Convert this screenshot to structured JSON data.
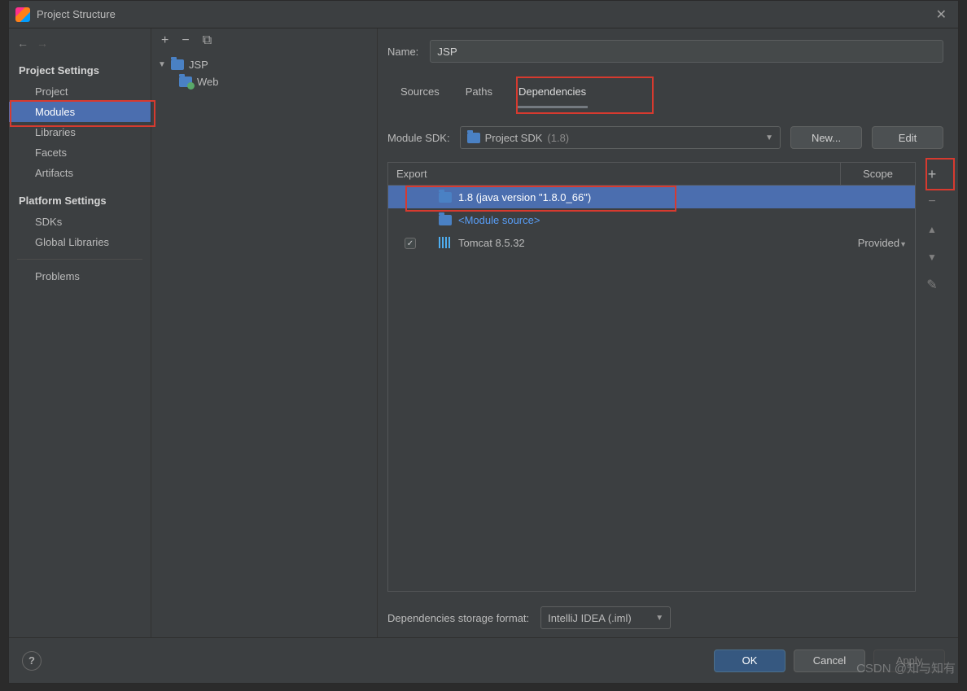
{
  "window": {
    "title": "Project Structure"
  },
  "sidebar": {
    "sections": [
      {
        "header": "Project Settings",
        "items": [
          {
            "label": "Project",
            "selected": false
          },
          {
            "label": "Modules",
            "selected": true
          },
          {
            "label": "Libraries",
            "selected": false
          },
          {
            "label": "Facets",
            "selected": false
          },
          {
            "label": "Artifacts",
            "selected": false
          }
        ]
      },
      {
        "header": "Platform Settings",
        "items": [
          {
            "label": "SDKs",
            "selected": false
          },
          {
            "label": "Global Libraries",
            "selected": false
          }
        ]
      }
    ],
    "problems": "Problems"
  },
  "tree": {
    "root": {
      "label": "JSP",
      "expanded": true
    },
    "children": [
      {
        "label": "Web"
      }
    ]
  },
  "module": {
    "name_label": "Name:",
    "name_value": "JSP",
    "tabs": [
      {
        "label": "Sources",
        "active": false
      },
      {
        "label": "Paths",
        "active": false
      },
      {
        "label": "Dependencies",
        "active": true
      }
    ],
    "sdk": {
      "label": "Module SDK:",
      "value": "Project SDK",
      "hint": "(1.8)",
      "new": "New...",
      "edit": "Edit"
    },
    "deps": {
      "header_export": "Export",
      "header_scope": "Scope",
      "rows": [
        {
          "checked": null,
          "icon": "folder",
          "text": "1.8 (java version \"1.8.0_66\")",
          "scope": "",
          "selected": true,
          "link": false
        },
        {
          "checked": null,
          "icon": "folder",
          "text": "<Module source>",
          "scope": "",
          "selected": false,
          "link": true
        },
        {
          "checked": true,
          "icon": "lib",
          "text": "Tomcat 8.5.32",
          "scope": "Provided",
          "selected": false,
          "link": false
        }
      ]
    },
    "storage": {
      "label": "Dependencies storage format:",
      "value": "IntelliJ IDEA (.iml)"
    }
  },
  "buttons": {
    "ok": "OK",
    "cancel": "Cancel",
    "apply": "Apply"
  },
  "watermark": "CSDN @知与知有"
}
